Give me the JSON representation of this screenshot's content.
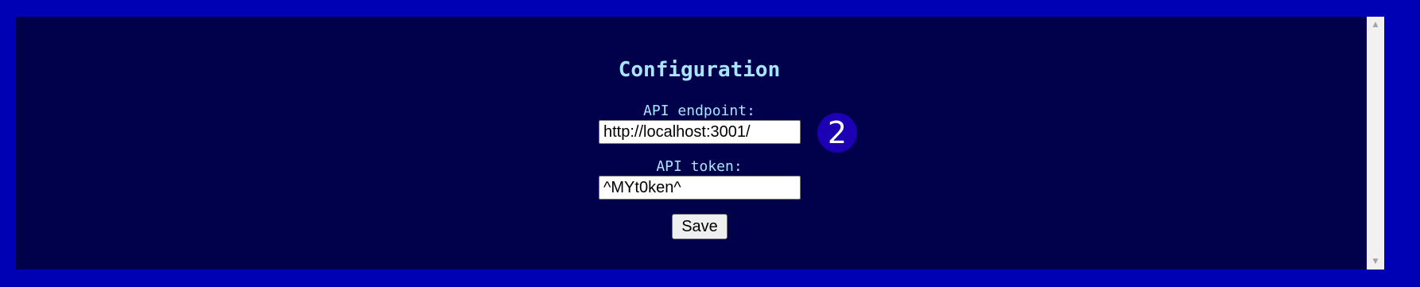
{
  "config": {
    "title": "Configuration",
    "endpoint_label": "API endpoint:",
    "endpoint_value": "http://localhost:3001/",
    "token_label": "API token:",
    "token_value": "^MYt0ken^",
    "save_label": "Save"
  },
  "badge": {
    "number": "2"
  },
  "scrollbar": {
    "up_icon": "▲",
    "down_icon": "▼"
  },
  "colors": {
    "outer_background": "#0000b4",
    "panel_background": "#00004b",
    "text_accent": "#a8e6ff",
    "badge_background": "#1d00b4"
  }
}
